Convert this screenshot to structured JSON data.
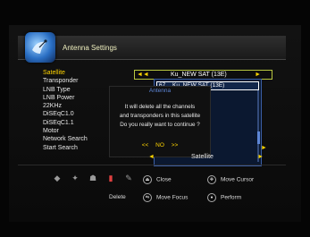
{
  "header": {
    "title": "Antenna Settings"
  },
  "menu": {
    "items": [
      {
        "label": "Satellite"
      },
      {
        "label": "Transponder"
      },
      {
        "label": "LNB Type"
      },
      {
        "label": "LNB Power"
      },
      {
        "label": "22KHz"
      },
      {
        "label": "DiSEqC1.0"
      },
      {
        "label": "DiSEqC1.1"
      },
      {
        "label": "Motor"
      },
      {
        "label": "Network Search"
      },
      {
        "label": "Start Search"
      }
    ]
  },
  "satellite_row": {
    "value": "Ku_NEW SAT (13E)",
    "left_arrow": "◄◄",
    "right_arrow": "►"
  },
  "dropdown": {
    "number": "67",
    "name": "Ku_NEW SAT (13E)"
  },
  "dialog": {
    "title": "Antenna",
    "message": [
      "It will delete all the channels",
      "and transponders in this satellite",
      "Do you really want to continue ?"
    ],
    "no_arrow_left": "<<",
    "no_label": "NO",
    "no_arrow_right": ">>"
  },
  "search_row": {
    "arrow_left": "◄",
    "value": "Satellite",
    "arrow_right": "►"
  },
  "footer": {
    "delete_label": "Delete",
    "close_label": "Close",
    "move_cursor_label": "Move Cursor",
    "move_focus_label": "Move Focus",
    "perform_label": "Perform"
  },
  "colors": {
    "highlight": "#ffd400",
    "accent": "#5d86d6",
    "border": "#b8c640"
  }
}
